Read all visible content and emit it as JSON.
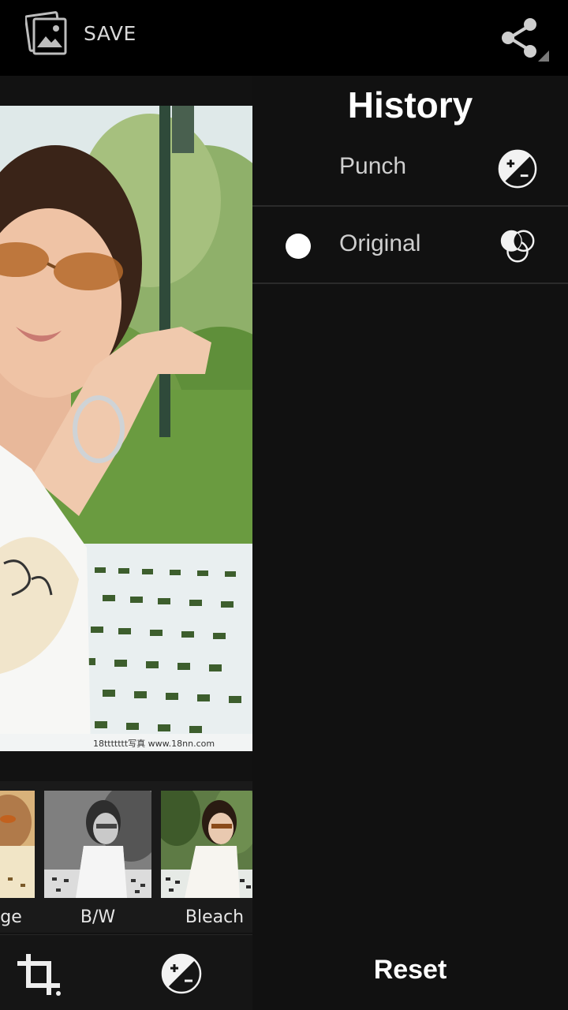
{
  "topbar": {
    "save_label": "SAVE",
    "gallery_icon": "gallery-icon",
    "share_icon": "share-icon"
  },
  "editor": {
    "photo_watermark": "18ttttttt写真 www.18nn.com",
    "filters": [
      {
        "label": "ge"
      },
      {
        "label": "B/W"
      },
      {
        "label": "Bleach"
      }
    ],
    "tools": [
      "crop-icon",
      "adjust-icon"
    ]
  },
  "history": {
    "title": "History",
    "items": [
      {
        "label": "Punch",
        "icon": "adjust-icon",
        "selected": false
      },
      {
        "label": "Original",
        "icon": "color-circles-icon",
        "selected": true
      }
    ],
    "reset_label": "Reset"
  },
  "colors": {
    "background": "#111111",
    "topbar": "#000000",
    "text_primary": "#ffffff",
    "text_secondary": "#cfcfcf"
  }
}
